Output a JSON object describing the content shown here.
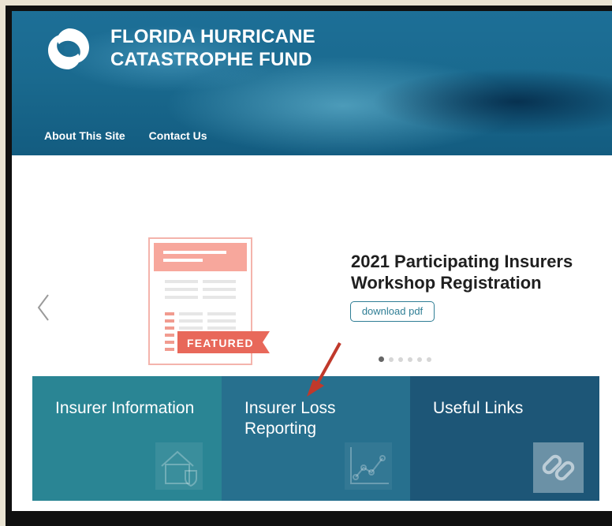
{
  "header": {
    "title_line1": "FLORIDA HURRICANE",
    "title_line2": "CATASTROPHE FUND",
    "logo_icon": "swirl-icon",
    "nav": [
      {
        "label": "About This Site"
      },
      {
        "label": "Contact Us"
      }
    ]
  },
  "carousel": {
    "badge": "FEATURED",
    "title": "2021 Participating Insurers Workshop Registration",
    "button_label": "download pdf",
    "dot_count": 6,
    "active_dot": 0,
    "prev_icon": "chevron-left-icon"
  },
  "tiles": [
    {
      "label": "Insurer Information",
      "icon": "house-shield-icon",
      "color": "#2a8594"
    },
    {
      "label": "Insurer Loss Reporting",
      "icon": "line-chart-icon",
      "color": "#27708e"
    },
    {
      "label": "Useful Links",
      "icon": "link-icon",
      "color": "#1d5677"
    }
  ],
  "colors": {
    "accent": "#2f7e95",
    "featured_red": "#e8685a",
    "annotation_arrow": "#c0392b"
  }
}
